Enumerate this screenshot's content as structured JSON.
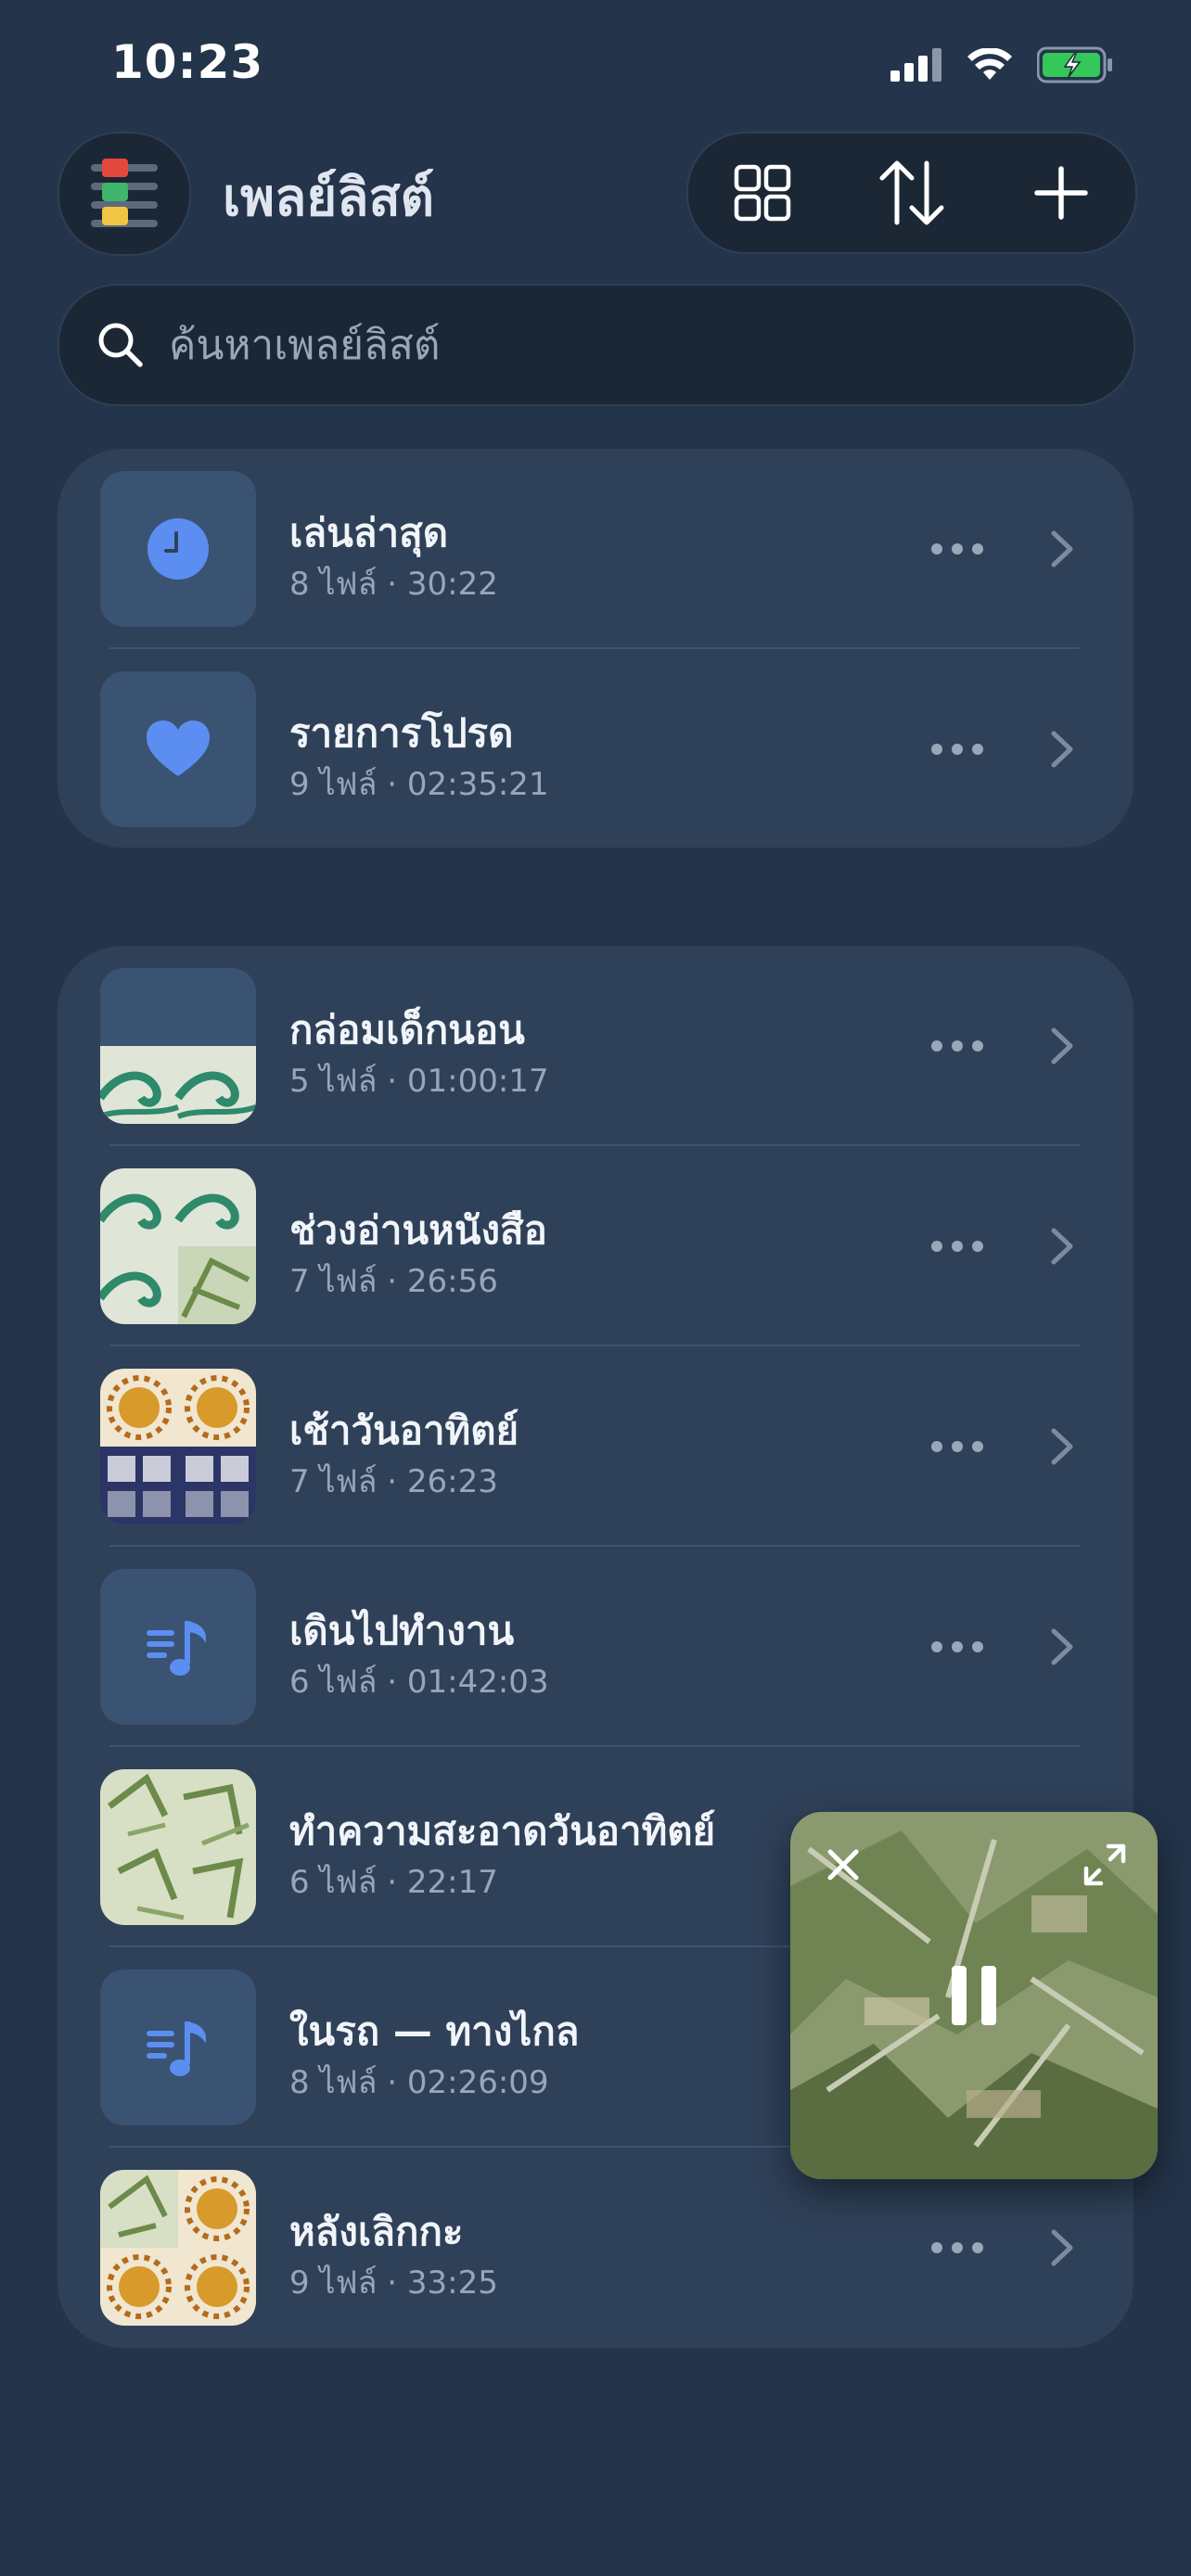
{
  "status": {
    "time": "10:23"
  },
  "header": {
    "title": "เพลย์ลิสต์"
  },
  "toolbar": {
    "grid": "grid-icon",
    "sort": "sort-icon",
    "add": "plus-icon"
  },
  "search": {
    "placeholder": "ค้นหาเพลย์ลิสต์"
  },
  "pinned": [
    {
      "title": "เล่นล่าสุด",
      "sub": "8 ไฟล์ · 30:22",
      "icon": "clock-icon"
    },
    {
      "title": "รายการโปรด",
      "sub": "9 ไฟล์ · 02:35:21",
      "icon": "heart-icon"
    }
  ],
  "playlists": [
    {
      "title": "กล่อมเด็กนอน",
      "sub": "5 ไฟล์ · 01:00:17",
      "art": "wave-half"
    },
    {
      "title": "ช่วงอ่านหนังสือ",
      "sub": "7 ไฟล์ · 26:56",
      "art": "wave-leaf"
    },
    {
      "title": "เช้าวันอาทิตย์",
      "sub": "7 ไฟล์ · 26:23",
      "art": "sun-window"
    },
    {
      "title": "เดินไปทำงาน",
      "sub": "6 ไฟล์ · 01:42:03",
      "art": "music-icon"
    },
    {
      "title": "ทำความสะอาดวันอาทิตย์",
      "sub": "6 ไฟล์ · 22:17",
      "art": "leaf"
    },
    {
      "title": "ในรถ — ทางไกล",
      "sub": "8 ไฟล์ · 02:26:09",
      "art": "music-icon"
    },
    {
      "title": "หลังเลิกกะ",
      "sub": "9 ไฟล์ · 33:25",
      "art": "leaf-sun"
    }
  ],
  "colors": {
    "accent": "#5b8ef0",
    "background": "#24344a",
    "card": "#2f4159"
  }
}
